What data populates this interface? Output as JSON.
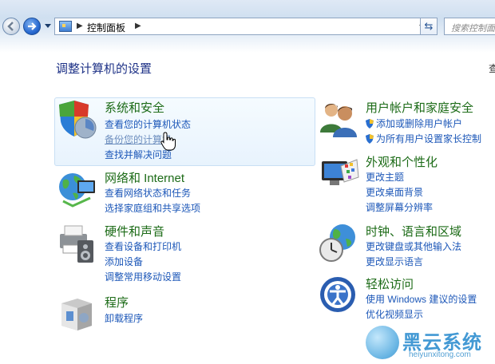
{
  "toolbar": {
    "breadcrumb": "控制面板",
    "search_placeholder": "搜索控制面"
  },
  "page": {
    "title": "调整计算机的设置",
    "view_by_cut": "查"
  },
  "left_categories": [
    {
      "title": "系统和安全",
      "icon": "shield-icon",
      "links": [
        "查看您的计算机状态",
        "备份您的计算机",
        "查找并解决问题"
      ]
    },
    {
      "title": "网络和 Internet",
      "icon": "network-globe-icon",
      "links": [
        "查看网络状态和任务",
        "选择家庭组和共享选项"
      ]
    },
    {
      "title": "硬件和声音",
      "icon": "printer-speaker-icon",
      "links": [
        "查看设备和打印机",
        "添加设备",
        "调整常用移动设置"
      ]
    },
    {
      "title": "程序",
      "icon": "programs-box-icon",
      "links": [
        "卸载程序"
      ]
    }
  ],
  "right_categories": [
    {
      "title": "用户帐户和家庭安全",
      "icon": "users-icon",
      "links": [
        "添加或删除用户帐户",
        "为所有用户设置家长控制"
      ]
    },
    {
      "title": "外观和个性化",
      "icon": "monitor-palette-icon",
      "links": [
        "更改主题",
        "更改桌面背景",
        "调整屏幕分辨率"
      ]
    },
    {
      "title": "时钟、语言和区域",
      "icon": "clock-globe-icon",
      "links": [
        "更改键盘或其他输入法",
        "更改显示语言"
      ]
    },
    {
      "title": "轻松访问",
      "icon": "ease-of-access-icon",
      "links": [
        "使用 Windows 建议的设置",
        "优化视频显示"
      ]
    }
  ],
  "watermark": {
    "title": "黑云系统",
    "url": "heiyunxitong.com"
  },
  "colors": {
    "category_title": "#1c6b17",
    "link": "#1c57b8",
    "page_title": "#1e3287",
    "watermark": "#2f8fd0"
  }
}
